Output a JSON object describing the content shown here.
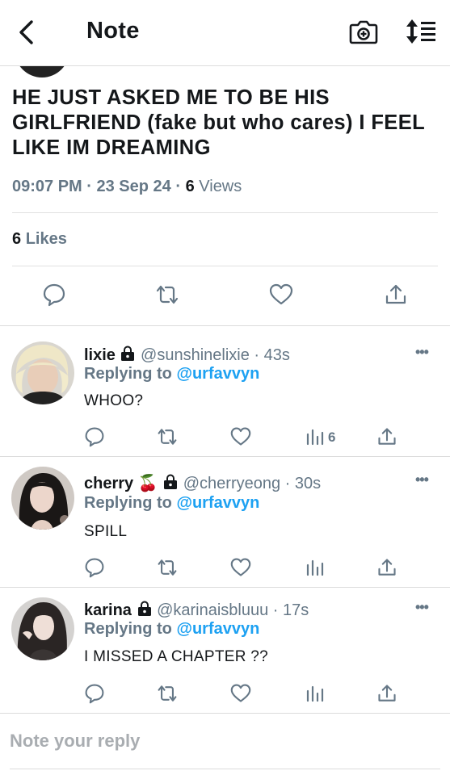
{
  "header": {
    "title": "Note",
    "icons": [
      "chevron-left-icon",
      "camera-plus-icon",
      "sort-icon"
    ]
  },
  "note": {
    "text": "HE JUST ASKED ME TO BE HIS GIRLFRIEND (fake but who cares) I FEEL LIKE IM DREAMING",
    "time": "09:07 PM",
    "date": "23 Sep 24",
    "views_count": "6",
    "views_label": "Views",
    "likes_count": "6",
    "likes_label": "Likes"
  },
  "replies": [
    {
      "name": "lixie",
      "emoji": "",
      "handle": "@sunshinelixie",
      "time": "43s",
      "replying_prefix": "Replying to",
      "replying_to": "@urfavvyn",
      "text": "WHOO?",
      "views": "6"
    },
    {
      "name": "cherry",
      "emoji": "🍒",
      "handle": "@cherryeong",
      "time": "30s",
      "replying_prefix": "Replying to",
      "replying_to": "@urfavvyn",
      "text": "SPILL",
      "views": ""
    },
    {
      "name": "karina",
      "emoji": "",
      "handle": "@karinaisbluuu",
      "time": "17s",
      "replying_prefix": "Replying to",
      "replying_to": "@urfavvyn",
      "text": "I MISSED A CHAPTER ??",
      "views": ""
    }
  ],
  "composer": {
    "placeholder": "Note your reply"
  },
  "colors": {
    "accent": "#1da1f2",
    "muted": "#657786",
    "text": "#14171a"
  }
}
